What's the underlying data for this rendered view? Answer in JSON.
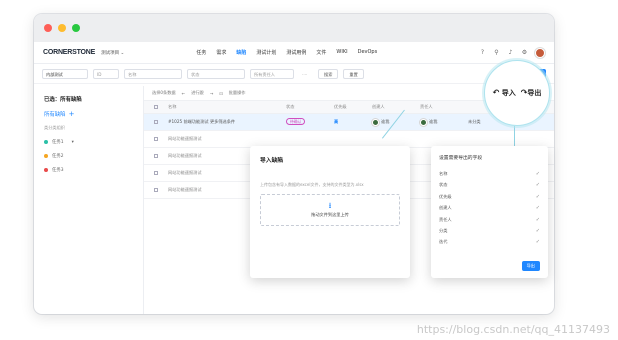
{
  "window": {
    "dot_colors": [
      "#fe5f57",
      "#febc2e",
      "#28c840"
    ]
  },
  "nav": {
    "logo": "CORNERSTONE",
    "project": "测试项目 ⌄",
    "menu": [
      {
        "label": "任务",
        "active": false
      },
      {
        "label": "需求",
        "active": false
      },
      {
        "label": "缺陷",
        "active": true
      },
      {
        "label": "测试计划",
        "active": false
      },
      {
        "label": "测试用例",
        "active": false
      },
      {
        "label": "文件",
        "active": false
      },
      {
        "label": "WIKI",
        "active": false
      },
      {
        "label": "DevOps",
        "active": false
      }
    ],
    "icons": [
      "help-icon",
      "search-icon",
      "bell-icon",
      "settings-icon"
    ]
  },
  "filters": {
    "scope": "内部测试",
    "id_placeholder": "ID",
    "name_placeholder": "名称",
    "status_placeholder": "状态",
    "owner_placeholder": "所有责任人",
    "more": "....",
    "search_btn": "搜索",
    "reset_btn": "重置",
    "create_btn": "+ 创建缺陷"
  },
  "sidebar": {
    "title": "已选：所有缺陷",
    "all_label": "所有缺陷",
    "plus": "+",
    "sub_label": "类分类组织",
    "items": [
      {
        "label": "任务1",
        "color": "#2bc0a7"
      },
      {
        "label": "任务2",
        "color": "#f5a623"
      },
      {
        "label": "任务3",
        "color": "#e94b4b"
      }
    ]
  },
  "table": {
    "toolbar": [
      "选择0条数据",
      "←",
      "进行跟",
      "→",
      "⊡",
      "批量操作"
    ],
    "headers": [
      "名称",
      "状态",
      "优先级",
      "创建人",
      "责任人",
      "分类"
    ],
    "rows": [
      {
        "title": "#1025 前端功能测试 更多筛选条件",
        "status": "待确认",
        "priority": "高",
        "creator": "谁我",
        "owner": "谁我",
        "category": "未分类",
        "selected": true
      },
      {
        "title": "网站功能速报测试",
        "status": "",
        "priority": "",
        "creator": "",
        "owner": "",
        "category": "",
        "selected": false
      },
      {
        "title": "网站功能速报测试",
        "status": "",
        "priority": "",
        "creator": "",
        "owner": "",
        "category": "",
        "selected": false
      },
      {
        "title": "网站功能速报测试",
        "status": "",
        "priority": "",
        "creator": "",
        "owner": "",
        "category": "",
        "selected": false
      },
      {
        "title": "网站功能速报测试",
        "status": "",
        "priority": "",
        "creator": "",
        "owner": "",
        "category": "",
        "selected": false
      }
    ]
  },
  "import_modal": {
    "title": "导入缺陷",
    "desc": "上传包含有导入数据的excel文件，支持的文件类型为.xlsx",
    "dropzone_text": "拖动文件到这里上传"
  },
  "export_panel": {
    "title": "设置需要导出的字段",
    "fields": [
      "名称",
      "状态",
      "优先级",
      "创建人",
      "责任人",
      "分类",
      "迭代"
    ],
    "button": "导出"
  },
  "magnifier": {
    "import_label": "导入",
    "export_label": "导出"
  },
  "watermark": "https://blog.csdn.net/qq_41137493"
}
